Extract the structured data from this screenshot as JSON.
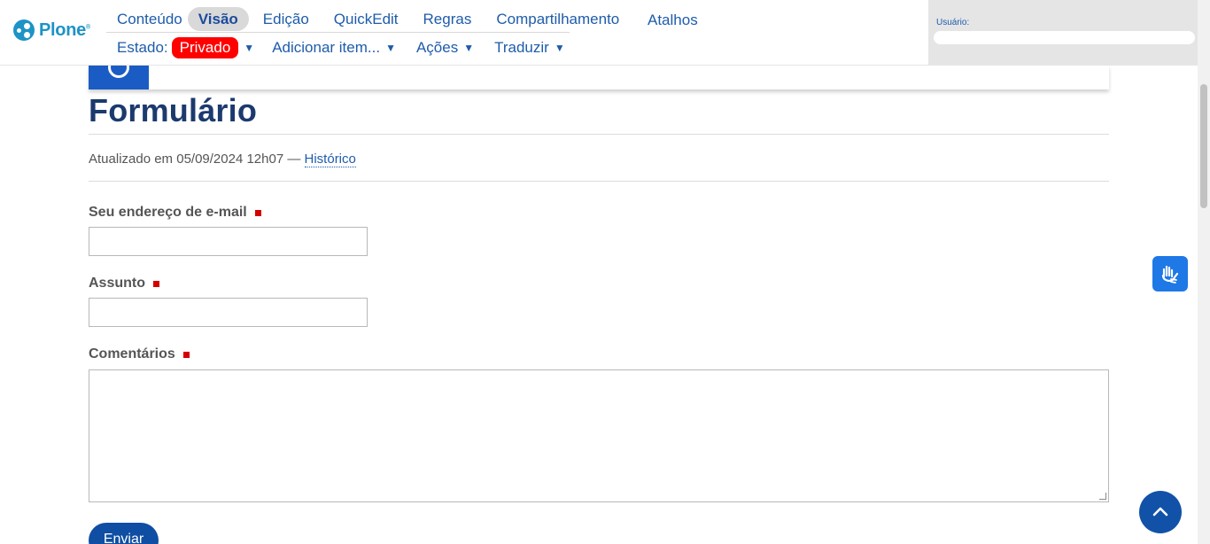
{
  "toolbar": {
    "logo_text": "Plone",
    "logo_mark": "®",
    "primary_items": [
      "Conteúdo",
      "Visão",
      "Edição",
      "QuickEdit",
      "Regras",
      "Compartilhamento",
      "Atalhos"
    ],
    "active_item": "Visão",
    "state_label": "Estado:",
    "state_value": "Privado",
    "state_color": "#ff0000",
    "secondary_menus": [
      "Adicionar item...",
      "Ações",
      "Traduzir"
    ],
    "caret": "▼",
    "user_label": "Usuário:",
    "user_value": ""
  },
  "page": {
    "title": "Formulário",
    "updated_text": "Atualizado em 05/09/2024 12h07 —",
    "history_link": "Histórico"
  },
  "form": {
    "email_label": "Seu endereço de e-mail",
    "email_value": "",
    "subject_label": "Assunto",
    "subject_value": "",
    "comments_label": "Comentários",
    "comments_value": "",
    "submit_label": "Enviar",
    "required_color": "#d40000"
  },
  "widgets": {
    "vlibras_icon": "hands-sign-language-icon",
    "back_to_top_icon": "chevron-up-icon"
  },
  "colors": {
    "link": "#1e5cab",
    "primary_button": "#0f4ea3",
    "title": "#1b3a6e"
  }
}
